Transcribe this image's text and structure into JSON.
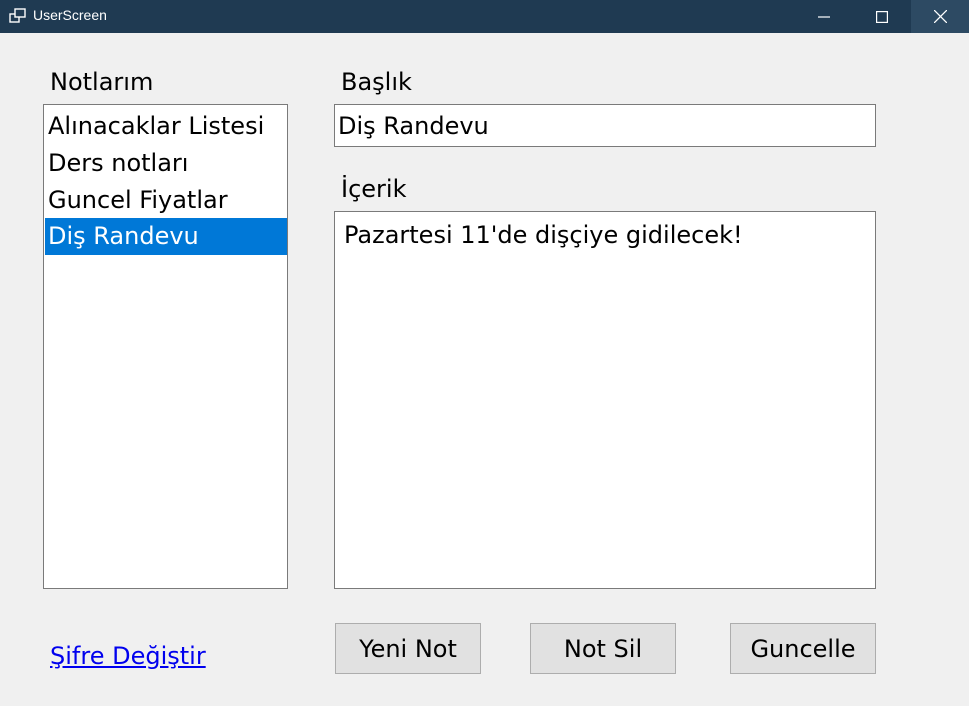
{
  "window": {
    "title": "UserScreen",
    "icon": "app-window-icon",
    "controls": [
      "minimize-icon",
      "maximize-icon",
      "close-icon"
    ]
  },
  "notes_panel": {
    "label": "Notlarım",
    "items": [
      {
        "label": "Alınacaklar Listesi",
        "selected": false
      },
      {
        "label": "Ders notları",
        "selected": false
      },
      {
        "label": "Guncel Fiyatlar",
        "selected": false
      },
      {
        "label": "Diş Randevu",
        "selected": true
      }
    ]
  },
  "editor": {
    "title_label": "Başlık",
    "title_value": "Diş Randevu",
    "content_label": "İçerik",
    "content_value": "Pazartesi 11'de dişçiye gidilecek!"
  },
  "footer": {
    "change_password_link": "Şifre Değiştir",
    "new_note_button": "Yeni Not",
    "delete_note_button": "Not Sil",
    "update_button": "Guncelle"
  },
  "colors": {
    "titlebar": "#1f3a52",
    "selection": "#0078d7",
    "link": "#0000ee"
  }
}
